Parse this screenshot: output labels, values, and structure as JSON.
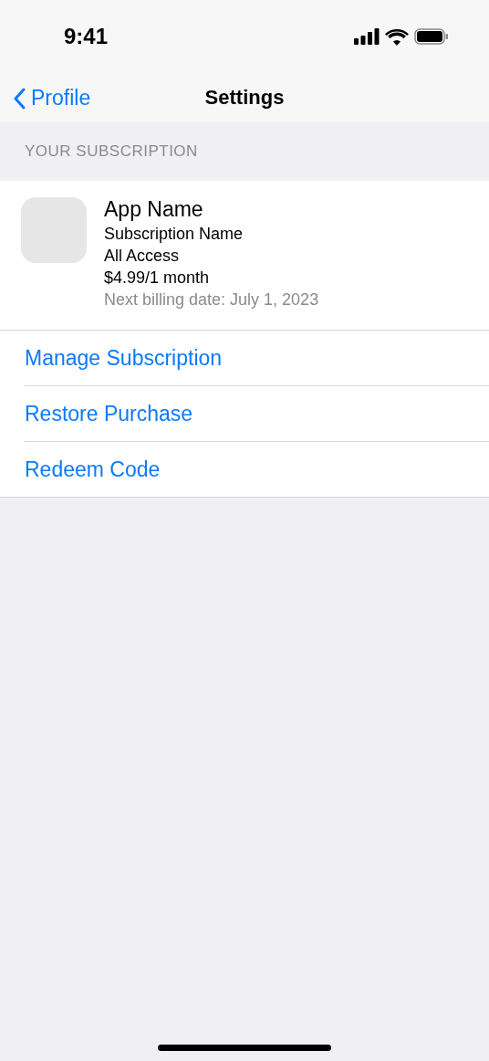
{
  "status_bar": {
    "time": "9:41"
  },
  "nav": {
    "back_label": "Profile",
    "title": "Settings"
  },
  "section": {
    "header": "YOUR SUBSCRIPTION"
  },
  "subscription": {
    "app_name": "App Name",
    "subscription_name": "Subscription Name",
    "tier": "All Access",
    "price": "$4.99/1 month",
    "next_billing": "Next billing date: July 1, 2023"
  },
  "actions": [
    {
      "label": "Manage Subscription"
    },
    {
      "label": "Restore Purchase"
    },
    {
      "label": "Redeem Code"
    }
  ]
}
